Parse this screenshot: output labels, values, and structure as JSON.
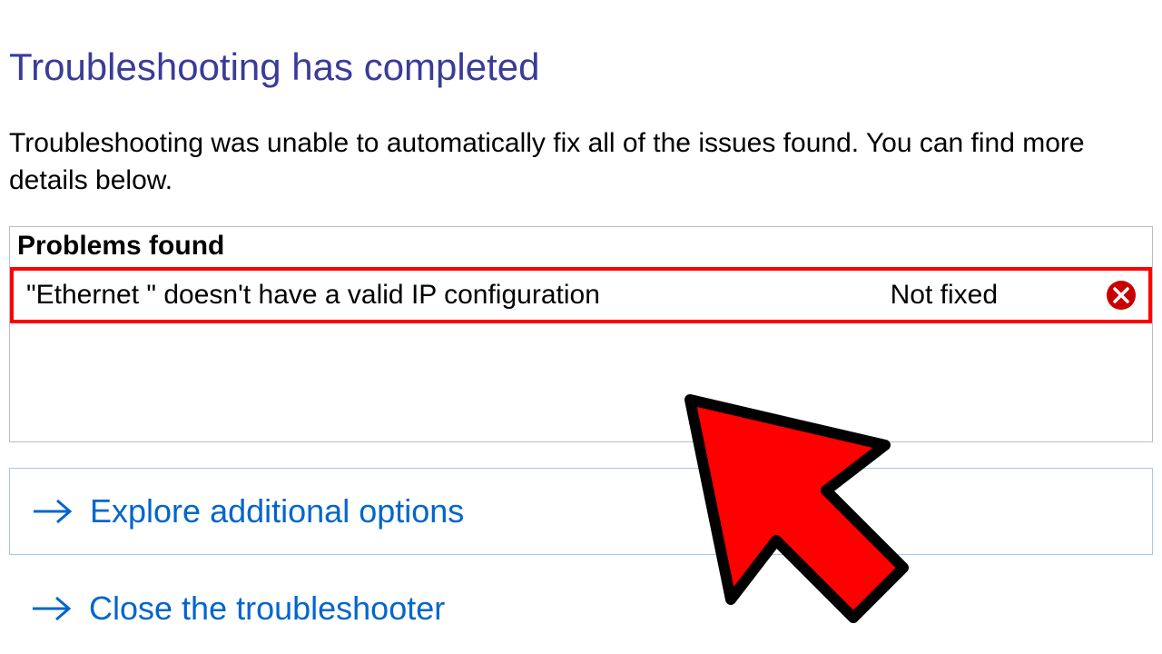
{
  "title": "Troubleshooting has completed",
  "description": "Troubleshooting was unable to automatically fix all of the issues found. You can find more details below.",
  "problems": {
    "header": "Problems found",
    "items": [
      {
        "description": "\"Ethernet \" doesn't have a valid IP configuration",
        "status": "Not fixed",
        "icon": "error-x-icon"
      }
    ]
  },
  "options": {
    "explore": "Explore additional options",
    "close": "Close the troubleshooter"
  },
  "colors": {
    "title": "#3b3b99",
    "link": "#0066cc",
    "highlight_border": "#ff0000",
    "error_icon": "#c80000"
  }
}
